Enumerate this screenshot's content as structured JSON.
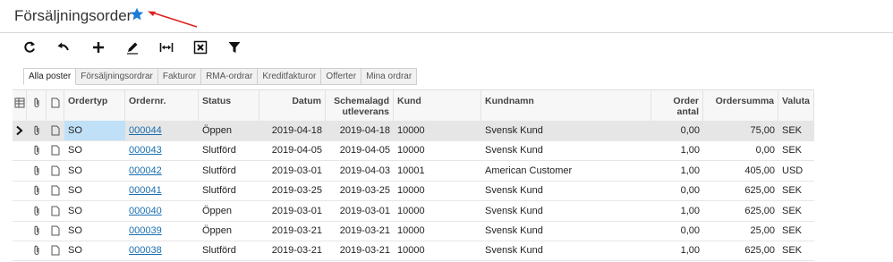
{
  "page": {
    "title": "Försäljningsorder",
    "star_color": "#1c7cd6",
    "arrow_color": "#e02020"
  },
  "toolbar": {
    "buttons": [
      {
        "name": "refresh-icon"
      },
      {
        "name": "undo-icon"
      },
      {
        "name": "add-icon"
      },
      {
        "name": "edit-icon"
      },
      {
        "name": "fit-columns-icon"
      },
      {
        "name": "export-excel-icon"
      },
      {
        "name": "filter-icon"
      }
    ]
  },
  "tabs": [
    {
      "label": "Alla poster",
      "active": true
    },
    {
      "label": "Försäljningsordrar"
    },
    {
      "label": "Fakturor"
    },
    {
      "label": "RMA-ordrar"
    },
    {
      "label": "Kreditfakturor"
    },
    {
      "label": "Offerter"
    },
    {
      "label": "Mina ordrar"
    }
  ],
  "grid": {
    "columns": {
      "ordertyp": "Ordertyp",
      "ordernr": "Ordernr.",
      "status": "Status",
      "datum": "Datum",
      "schemalagd_1": "Schemalagd",
      "schemalagd_2": "utleverans",
      "kund": "Kund",
      "kundnamn": "Kundnamn",
      "order_antal": "Order antal",
      "ordersumma": "Ordersumma",
      "valuta": "Valuta"
    },
    "rows": [
      {
        "typ": "SO",
        "nr": "000044",
        "status": "Öppen",
        "datum": "2019-04-18",
        "sched": "2019-04-18",
        "kund": "10000",
        "namn": "Svensk Kund",
        "antal": "0,00",
        "summa": "75,00",
        "valuta": "SEK"
      },
      {
        "typ": "SO",
        "nr": "000043",
        "status": "Slutförd",
        "datum": "2019-04-05",
        "sched": "2019-04-05",
        "kund": "10000",
        "namn": "Svensk Kund",
        "antal": "1,00",
        "summa": "0,00",
        "valuta": "SEK"
      },
      {
        "typ": "SO",
        "nr": "000042",
        "status": "Slutförd",
        "datum": "2019-03-01",
        "sched": "2019-04-03",
        "kund": "10001",
        "namn": "American Customer",
        "antal": "1,00",
        "summa": "405,00",
        "valuta": "USD"
      },
      {
        "typ": "SO",
        "nr": "000041",
        "status": "Slutförd",
        "datum": "2019-03-25",
        "sched": "2019-03-25",
        "kund": "10000",
        "namn": "Svensk Kund",
        "antal": "0,00",
        "summa": "625,00",
        "valuta": "SEK"
      },
      {
        "typ": "SO",
        "nr": "000040",
        "status": "Öppen",
        "datum": "2019-03-01",
        "sched": "2019-03-01",
        "kund": "10000",
        "namn": "Svensk Kund",
        "antal": "1,00",
        "summa": "625,00",
        "valuta": "SEK"
      },
      {
        "typ": "SO",
        "nr": "000039",
        "status": "Öppen",
        "datum": "2019-03-21",
        "sched": "2019-03-21",
        "kund": "10000",
        "namn": "Svensk Kund",
        "antal": "0,00",
        "summa": "25,00",
        "valuta": "SEK"
      },
      {
        "typ": "SO",
        "nr": "000038",
        "status": "Slutförd",
        "datum": "2019-03-21",
        "sched": "2019-03-21",
        "kund": "10000",
        "namn": "Svensk Kund",
        "antal": "1,00",
        "summa": "625,00",
        "valuta": "SEK"
      }
    ]
  }
}
